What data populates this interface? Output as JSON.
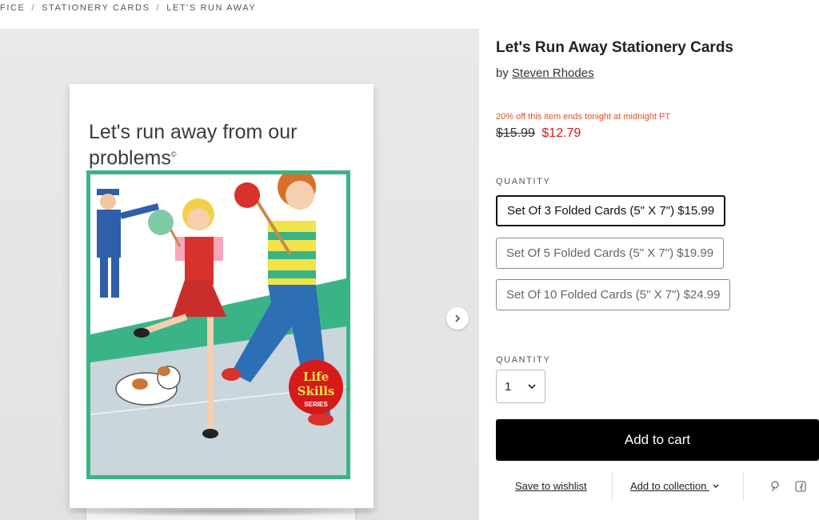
{
  "breadcrumb": {
    "items": [
      "FICE",
      "STATIONERY CARDS",
      "LET'S RUN AWAY"
    ],
    "separator": "/"
  },
  "gallery": {
    "card_text": "Let's run away from our problems",
    "card_mark": "©",
    "badge_line1": "Life",
    "badge_line2": "Skills",
    "badge_line3": "SERIES",
    "next_icon": "chevron-right-icon"
  },
  "product": {
    "title": "Let's Run Away Stationery Cards",
    "by": "by",
    "artist": "Steven Rhodes",
    "promo": "20% off this item ends tonight at midnight PT",
    "old_price": "$15.99",
    "new_price": "$12.79"
  },
  "options": {
    "label": "QUANTITY",
    "items": [
      {
        "label": "Set Of 3 Folded Cards (5\" X 7\") $15.99",
        "selected": true
      },
      {
        "label": "Set Of 5 Folded Cards (5\" X 7\") $19.99",
        "selected": false
      },
      {
        "label": "Set Of 10 Folded Cards (5\" X 7\") $24.99",
        "selected": false
      }
    ]
  },
  "quantity": {
    "label": "QUANTITY",
    "value": "1"
  },
  "cart": {
    "button": "Add to cart"
  },
  "actions": {
    "wishlist": "Save to wishlist",
    "collection": "Add to collection",
    "icons": [
      "pinterest-icon",
      "facebook-icon"
    ]
  },
  "colors": {
    "promo": "#e0502d",
    "sale_price": "#d61a1a",
    "button_bg": "#000000",
    "frame_green": "#3ab486"
  }
}
